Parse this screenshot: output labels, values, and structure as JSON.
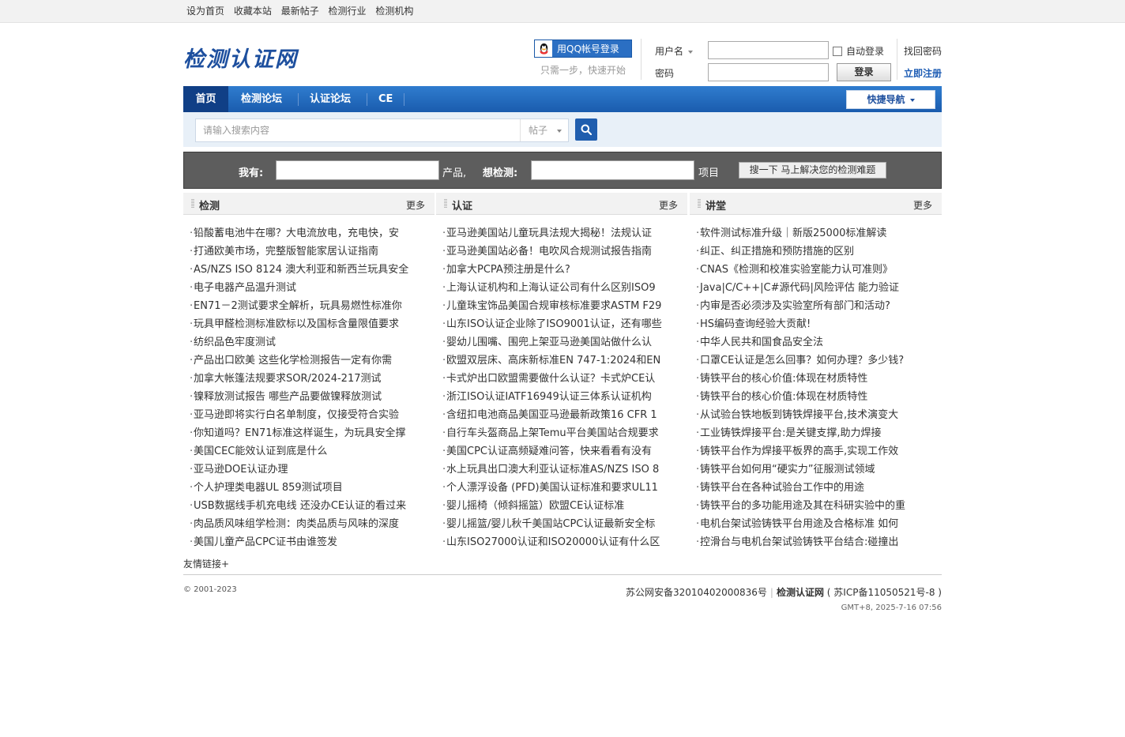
{
  "topbar": {
    "links": [
      "设为首页",
      "收藏本站",
      "最新帖子",
      "检测行业",
      "检测机构"
    ]
  },
  "header": {
    "logo_text": "检测认证网",
    "qq_login_label": "用QQ帐号登录",
    "qq_tip": "只需一步，快速开始",
    "username_label": "用户名",
    "password_label": "密码",
    "auto_login_label": "自动登录",
    "login_button": "登录",
    "find_password": "找回密码",
    "register": "立即注册"
  },
  "nav": {
    "items": [
      "首页",
      "检测论坛",
      "认证论坛",
      "CE"
    ],
    "quick_nav": "快捷导航"
  },
  "search": {
    "placeholder": "请输入搜索内容",
    "type": "帖子"
  },
  "test_search": {
    "label_have": "我有:",
    "label_product": "产品,",
    "label_want": "想检测:",
    "label_item": "项目",
    "button": "搜一下 马上解决您的检测难题"
  },
  "columns": [
    {
      "title": "检测",
      "more": "更多",
      "items": [
        "铅酸蓄电池牛在哪？大电流放电，充电快，安",
        "打通欧美市场，完整版智能家居认证指南",
        "AS/NZS ISO 8124 澳大利亚和新西兰玩具安全",
        "电子电器产品温升测试",
        "EN71－2测试要求全解析，玩具易燃性标准你",
        "玩具甲醛检测标准欧标以及国标含量限值要求",
        "纺织品色牢度测试",
        "产品出口欧美 这些化学检测报告一定有你需",
        "加拿大帐篷法规要求SOR/2024-217测试",
        "镍释放测试报告 哪些产品要做镍释放测试",
        "亚马逊即将实行白名单制度，仅接受符合实验",
        "你知道吗？EN71标准这样诞生，为玩具安全撑",
        "美国CEC能效认证到底是什么",
        "亚马逊DOE认证办理",
        "个人护理类电器UL 859测试项目",
        "USB数据线手机充电线 还没办CE认证的看过来",
        "肉品质风味组学检测：肉类品质与风味的深度",
        "美国儿童产品CPC证书由谁签发"
      ]
    },
    {
      "title": "认证",
      "more": "更多",
      "items": [
        "亚马逊美国站儿童玩具法规大揭秘！法规认证",
        "亚马逊美国站必备！电吹风合规测试报告指南",
        "加拿大PCPA预注册是什么?",
        "上海认证机构和上海认证公司有什么区别ISO9",
        "儿童珠宝饰品美国合规审核标准要求ASTM F29",
        "山东ISO认证企业除了ISO9001认证，还有哪些",
        "婴幼儿围嘴、围兜上架亚马逊美国站做什么认",
        "欧盟双层床、高床新标准EN 747-1:2024和EN",
        "卡式炉出口欧盟需要做什么认证？卡式炉CE认",
        "浙江ISO认证IATF16949认证三体系认证机构",
        "含纽扣电池商品美国亚马逊最新政策16 CFR 1",
        "自行车头盔商品上架Temu平台美国站合规要求",
        "美国CPC认证高频疑难问答，快来看看有没有",
        "水上玩具出口澳大利亚认证标准AS/NZS ISO 8",
        "个人漂浮设备 (PFD)美国认证标准和要求UL11",
        "婴儿摇椅（倾斜摇篮）欧盟CE认证标准",
        "婴儿摇篮/婴儿秋千美国站CPC认证最新安全标",
        "山东ISO27000认证和ISO20000认证有什么区"
      ]
    },
    {
      "title": "讲堂",
      "more": "更多",
      "items": [
        "软件测试标准升级｜新版25000标准解读",
        "纠正、纠正措施和预防措施的区别",
        "CNAS《检测和校准实验室能力认可准则》",
        "Java|C/C++|C#源代码|风险评估 能力验证",
        "内审是否必须涉及实验室所有部门和活动?",
        "HS编码查询经验大贡献!",
        "中华人民共和国食品安全法",
        "口罩CE认证是怎么回事？如何办理？多少钱?",
        "铸铁平台的核心价值:体现在材质特性",
        "铸铁平台的核心价值:体现在材质特性",
        "从试验台铁地板到铸铁焊接平台,技术演变大",
        "工业铸铁焊接平台:是关键支撑,助力焊接",
        "铸铁平台作为焊接平板界的高手,实现工作效",
        "铸铁平台如何用“硬实力”征服测试领域",
        "铸铁平台在各种试验台工作中的用途",
        "铸铁平台的多功能用途及其在科研实验中的重",
        "电机台架试验铸铁平台用途及合格标准 如何",
        "控滑台与电机台架试验铸铁平台结合:碰撞出"
      ]
    }
  ],
  "footer": {
    "friend_links": "友情链接+",
    "copyright": "© 2001-2023",
    "police": "苏公网安备32010402000836号",
    "site_name": "检测认证网",
    "icp": "( 苏ICP备11050521号-8 )",
    "time": "GMT+8, 2025-7-16 07:56"
  },
  "colors": {
    "nav_blue": "#2f7ccf",
    "nav_active": "#103f86",
    "logo_blue": "#1d4f9e",
    "test_bar_gray": "#5d5d5d"
  }
}
